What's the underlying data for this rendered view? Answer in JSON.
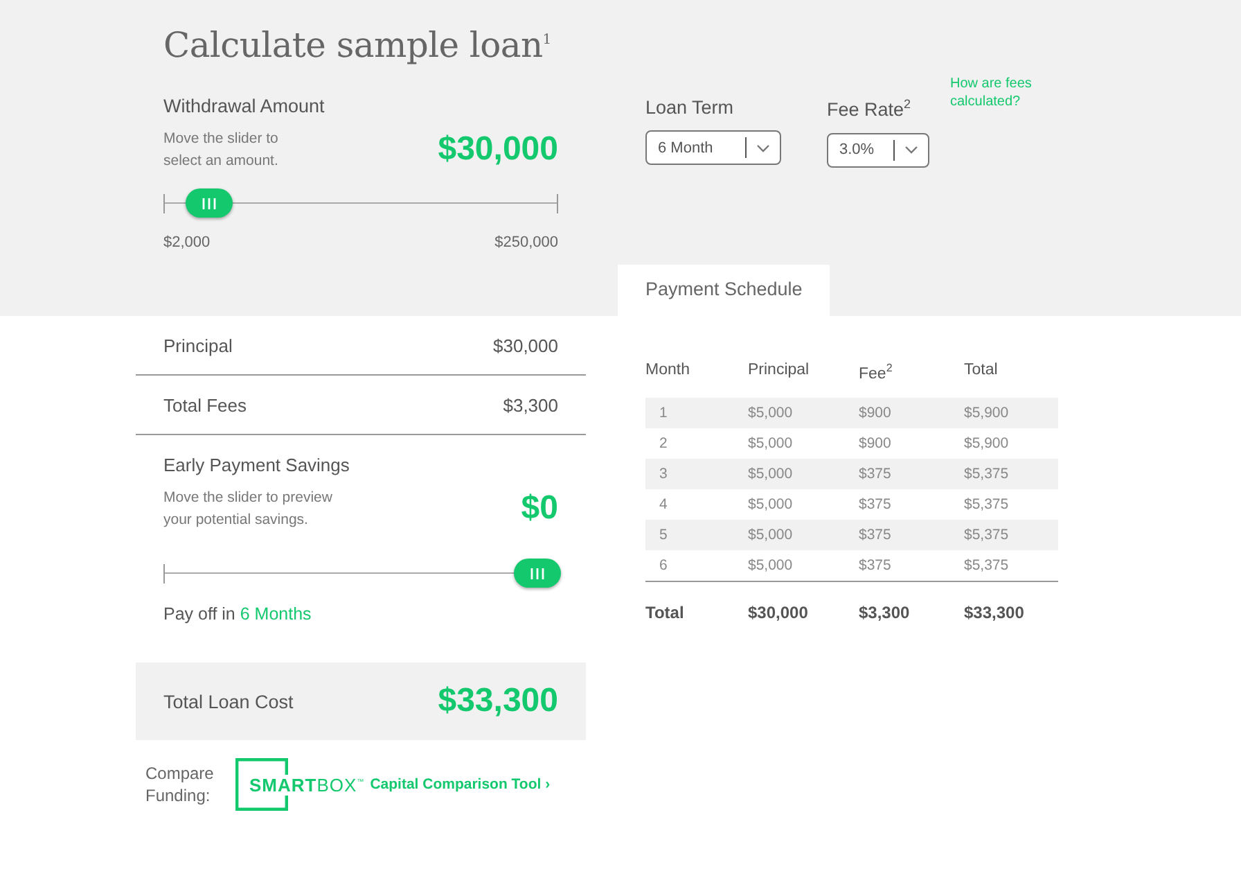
{
  "title": "Calculate sample loan$^{1}$",
  "withdrawal": {
    "label": "Withdrawal Amount",
    "hint": "Move the slider to select an amount.",
    "amount": "$30,000",
    "level": 0.113,
    "min": "$2,000",
    "max": "$250,000"
  },
  "selects": [
    {
      "label": "Loan Term",
      "value": "6 Month"
    },
    {
      "label": "Fee Rate$^{2}$",
      "value": "3.0%"
    }
  ],
  "fees_link": "How are fees calculated?",
  "tabs": [
    {
      "label": "Payment Schedule",
      "selected": true
    }
  ],
  "summary": [
    {
      "label": "Principal",
      "value": "$30,000"
    },
    {
      "label": "Total Fees",
      "value": "$3,300"
    }
  ],
  "early": {
    "label": "Early Payment Savings",
    "hint": "Move the slider to preview your potential savings.",
    "amount": "$0",
    "level": 1,
    "payoff_prefix": "Pay off in",
    "payoff_value": "6 Months"
  },
  "total_cost": {
    "label": "Total Loan Cost",
    "value": "$33,300"
  },
  "compare": {
    "label": "Compare Funding:",
    "logo_bold": "SMART",
    "logo_light": "BOX",
    "logo_mark": "™",
    "link": "Capital Comparison Tool ›"
  },
  "table": {
    "columns": [
      "Month",
      "Principal",
      "Fee$^{2}$",
      "Total"
    ],
    "rows": [
      [
        "1",
        "$5,000",
        "$900",
        "$5,900"
      ],
      [
        "2",
        "$5,000",
        "$900",
        "$5,900"
      ],
      [
        "3",
        "$5,000",
        "$375",
        "$5,375"
      ],
      [
        "4",
        "$5,000",
        "$375",
        "$5,375"
      ],
      [
        "5",
        "$5,000",
        "$375",
        "$5,375"
      ],
      [
        "6",
        "$5,000",
        "$375",
        "$5,375"
      ]
    ],
    "total": [
      "Total",
      "$30,000",
      "$3,300",
      "$33,300"
    ]
  }
}
